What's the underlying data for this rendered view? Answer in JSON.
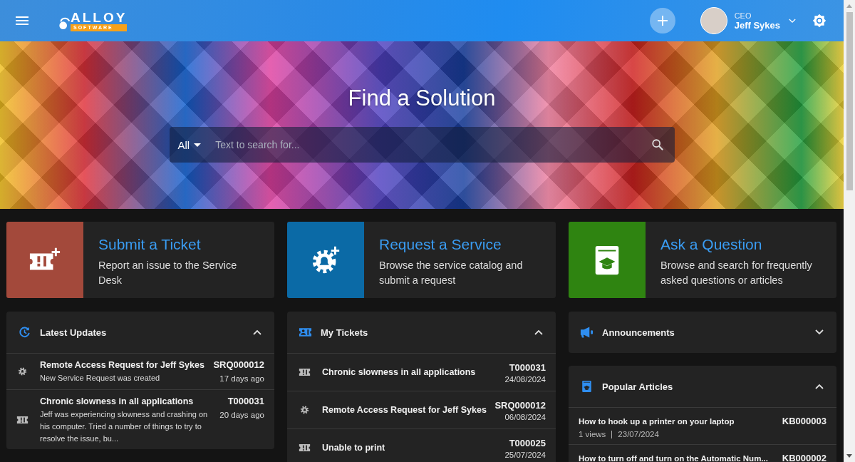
{
  "header": {
    "logo": {
      "word": "ALLOY",
      "tagline": "SOFTWARE"
    },
    "user": {
      "role": "CEO",
      "name": "Jeff Sykes"
    }
  },
  "hero": {
    "title": "Find a Solution",
    "search": {
      "scope": "All",
      "placeholder": "Text to search for..."
    }
  },
  "actions": [
    {
      "title": "Submit a Ticket",
      "description": "Report an issue to the Service Desk",
      "color": "#a3493b",
      "kind": "ticket"
    },
    {
      "title": "Request a Service",
      "description": "Browse the service catalog and submit a request",
      "color": "#0b6aa6",
      "kind": "service"
    },
    {
      "title": "Ask a Question",
      "description": "Browse and search for frequently asked questions or articles",
      "color": "#2f8411",
      "kind": "knowledge"
    }
  ],
  "columns": [
    {
      "panels": [
        {
          "title": "Latest Updates",
          "kind": "updates",
          "expanded": true,
          "items": [
            {
              "kind": "service_request",
              "title": "Remote Access Request for Jeff Sykes",
              "detail": "New Service Request was created",
              "id": "SRQ000012",
              "date": "17 days ago"
            },
            {
              "kind": "ticket",
              "title": "Chronic slowness in all applications",
              "detail": "Jeff was experiencing slowness and crashing on his computer. Tried a number of things to try to resolve the issue, bu...",
              "id": "T000031",
              "date": "20 days ago"
            }
          ]
        }
      ]
    },
    {
      "panels": [
        {
          "title": "My Tickets",
          "kind": "tickets",
          "expanded": true,
          "items": [
            {
              "kind": "ticket",
              "title": "Chronic slowness in all applications",
              "id": "T000031",
              "date": "24/08/2024"
            },
            {
              "kind": "service_request",
              "title": "Remote Access Request for Jeff Sykes",
              "id": "SRQ000012",
              "date": "06/08/2024"
            },
            {
              "kind": "ticket",
              "title": "Unable to print",
              "id": "T000025",
              "date": "25/07/2024"
            }
          ]
        }
      ]
    },
    {
      "panels": [
        {
          "title": "Announcements",
          "kind": "announcements",
          "expanded": false
        },
        {
          "title": "Popular Articles",
          "kind": "articles",
          "expanded": true,
          "items": [
            {
              "title": "How to hook up a printer on your laptop",
              "views": "1 views",
              "date": "23/07/2024",
              "id": "KB000003"
            },
            {
              "title": "How to turn off and turn on the Automatic Num...",
              "id": "KB000002"
            }
          ]
        }
      ]
    }
  ]
}
